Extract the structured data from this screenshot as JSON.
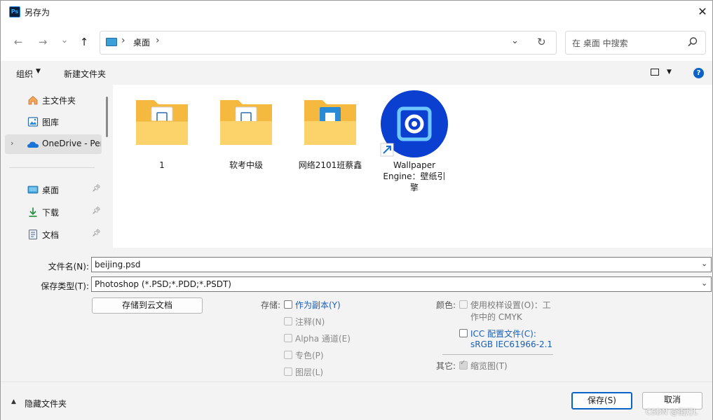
{
  "window": {
    "title": "另存为",
    "app_icon": "Ps",
    "close_icon": "✕"
  },
  "nav": {
    "back": "←",
    "forward": "→",
    "recent": "⌄",
    "up": "↑",
    "breadcrumb": [
      "桌面"
    ],
    "address_dropdown": "⌄",
    "refresh": "↻",
    "search_placeholder": "在 桌面 中搜索"
  },
  "toolbar": {
    "organize": "组织",
    "new_folder": "新建文件夹",
    "help": "?"
  },
  "sidebar": {
    "items": [
      {
        "label": "主文件夹",
        "icon": "home-icon"
      },
      {
        "label": "图库",
        "icon": "gallery-icon"
      },
      {
        "label": "OneDrive - Per",
        "icon": "onedrive-icon"
      },
      {
        "label": "桌面",
        "icon": "desktop-icon"
      },
      {
        "label": "下载",
        "icon": "download-icon"
      },
      {
        "label": "文档",
        "icon": "document-icon"
      }
    ]
  },
  "files": [
    {
      "label": "1",
      "type": "folder"
    },
    {
      "label": "软考中级",
      "type": "folder"
    },
    {
      "label": "网络2101班蔡鑫",
      "type": "folder"
    },
    {
      "label_lines": [
        "Wallpaper",
        "Engine：壁纸引",
        "擎"
      ],
      "type": "shortcut"
    }
  ],
  "form": {
    "filename_label": "文件名(N):",
    "filename_value": "beijing.psd",
    "filetype_label": "保存类型(T):",
    "filetype_value": "Photoshop (*.PSD;*.PDD;*.PSDT)",
    "cloud_button": "存储到云文档",
    "save_label": "存储:",
    "save_options": [
      {
        "label": "作为副本(Y)",
        "enabled": true
      },
      {
        "label": "注释(N)",
        "enabled": false
      },
      {
        "label": "Alpha 通道(E)",
        "enabled": false
      },
      {
        "label": "专色(P)",
        "enabled": false
      },
      {
        "label": "图层(L)",
        "enabled": false
      }
    ],
    "color_label": "颜色:",
    "proof_setup_line1": "使用校样设置(O)：工",
    "proof_setup_line2": "作中的 CMYK",
    "icc_line1": "ICC 配置文件(C):",
    "icc_line2": "sRGB IEC61966-2.1",
    "other_label": "其它:",
    "thumbnail": "缩览图(T)"
  },
  "footer": {
    "hide_folders": "隐藏文件夹",
    "save": "保存(S)",
    "cancel": "取消"
  },
  "watermark": "CSDN @街灯L"
}
